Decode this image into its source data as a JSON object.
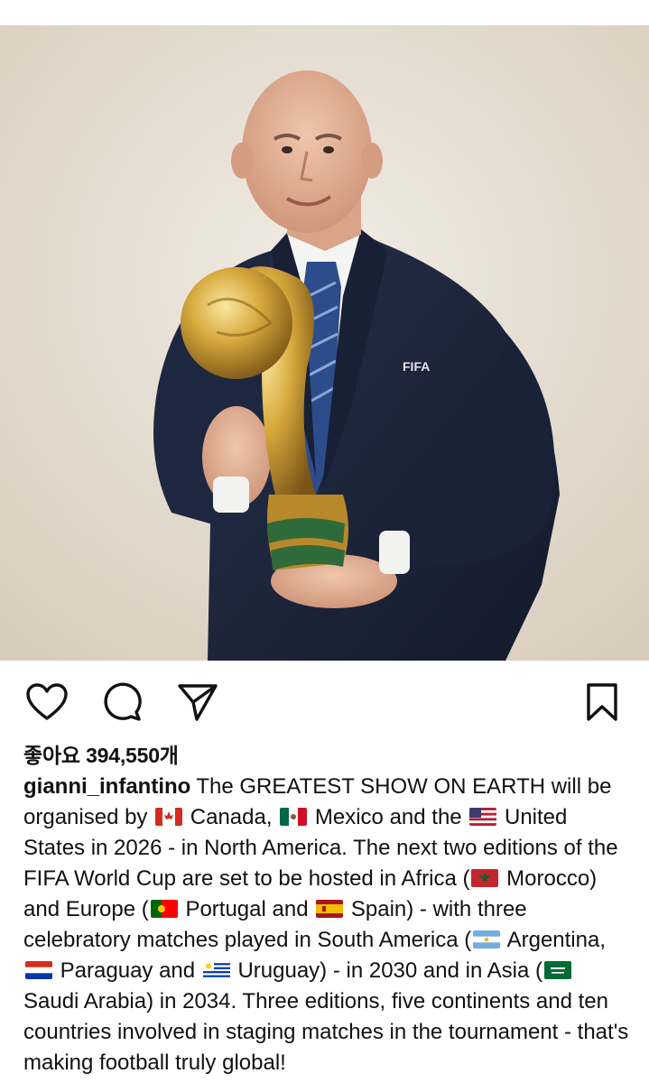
{
  "post": {
    "photo_label": "FIFA",
    "likes_text": "좋아요 394,550개",
    "username": "gianni_infantino",
    "caption": {
      "s1": "The GREATEST SHOW ON EARTH will be organised by",
      "s2": "Canada,",
      "s3": "Mexico and the",
      "s4": "United States in 2026 - in North America. The next two editions of the FIFA World Cup are set to be hosted in Africa (",
      "s5": "Morocco) and Europe (",
      "s6": "Portugal and",
      "s7": "Spain) - with three celebratory matches played in South America (",
      "s8": "Argentina,",
      "s9": "Paraguay and",
      "s10": "Uruguay) - in 2030 and in Asia (",
      "s11": "Saudi Arabia) in 2034. Three editions, five continents and ten countries involved in staging matches in the tournament - that's making football truly global!"
    }
  },
  "icons": {
    "like": "heart-icon",
    "comment": "comment-icon",
    "share": "paper-plane-icon",
    "save": "bookmark-icon"
  },
  "colors": {
    "text": "#111111",
    "background": "#ffffff",
    "photo_background": "#e6ddd1",
    "suit": "#1c2438",
    "trophy_gold": "#c99a2e",
    "trophy_green": "#2f6a3a"
  }
}
